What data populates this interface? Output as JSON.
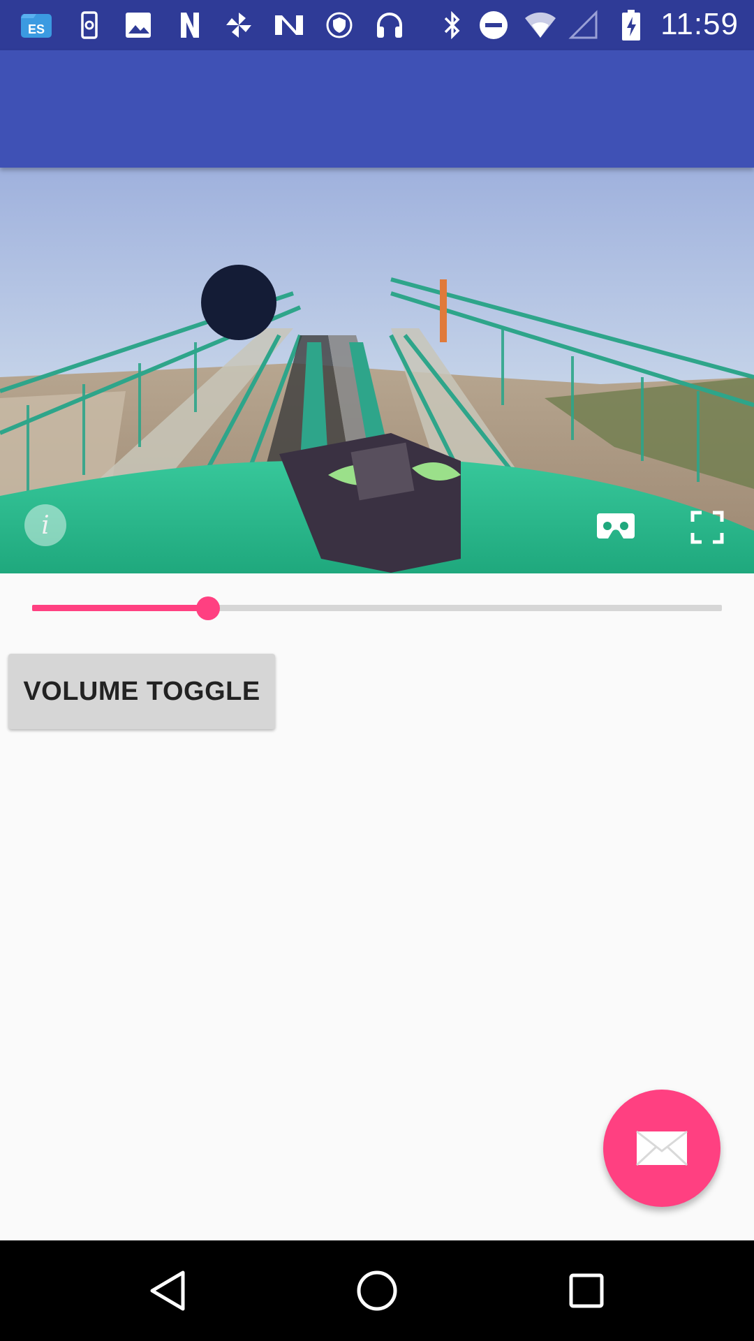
{
  "status_bar": {
    "time": "11:59",
    "icons": [
      "es-file-explorer-icon",
      "phone-sync-icon",
      "image-icon",
      "n-app-icon",
      "pinwheel-icon",
      "n-logo-icon",
      "vpn-shield-icon",
      "headphones-icon",
      "bluetooth-icon",
      "do-not-disturb-icon",
      "wifi-icon",
      "cell-signal-icon",
      "battery-charging-icon"
    ]
  },
  "app_bar": {
    "title": ""
  },
  "video": {
    "info_label": "i",
    "icons": {
      "info": "info-icon",
      "vr": "cardboard-vr-icon",
      "fullscreen": "fullscreen-icon"
    }
  },
  "seekbar": {
    "progress": 0.255
  },
  "controls": {
    "volume_toggle_label": "VOLUME TOGGLE"
  },
  "fab": {
    "icon": "email-icon"
  },
  "nav_bar": {
    "icons": [
      "back-icon",
      "home-icon",
      "recents-icon"
    ]
  },
  "colors": {
    "primary": "#3f51b5",
    "primary_dark": "#2f3b97",
    "accent": "#ff4081",
    "background": "#fafafa"
  }
}
